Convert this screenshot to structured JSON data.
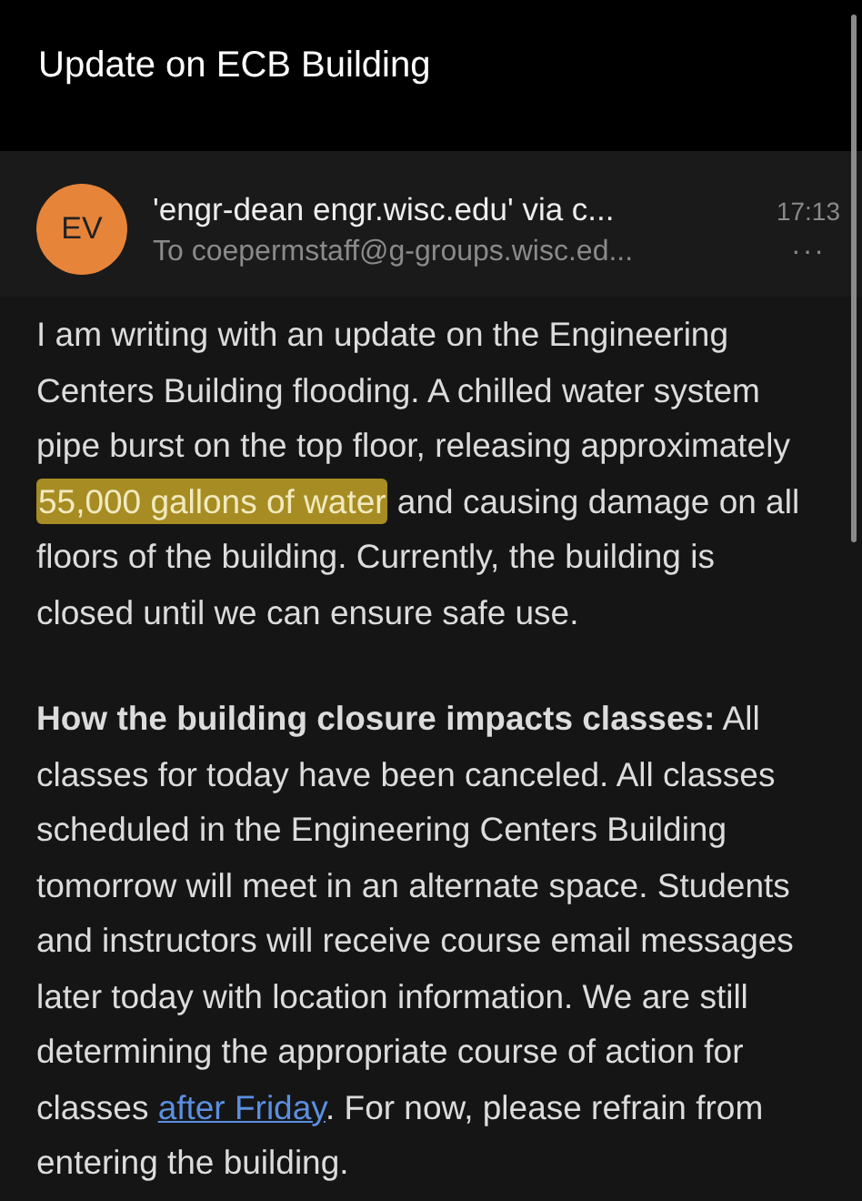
{
  "header": {
    "title": "Update on ECB Building"
  },
  "message": {
    "avatar_initials": "EV",
    "sender": "'engr-dean engr.wisc.edu' via c...",
    "time": "17:13",
    "recipient": "To coepermstaff@g-groups.wisc.ed...",
    "more": "···"
  },
  "body": [
    [
      {
        "kind": "plain",
        "text": "I am writing with an update on the Engineering Centers Building flooding. A chilled water system pipe burst on the top floor, releasing approximately "
      },
      {
        "kind": "highlight",
        "text": "55,000 gallons of water"
      },
      {
        "kind": "plain",
        "text": " and causing damage on all floors of the building. Currently, the building is closed until we can ensure safe use."
      }
    ],
    [
      {
        "kind": "bold",
        "text": "How the building closure impacts classes:"
      },
      {
        "kind": "plain",
        "text": " All classes for today have been canceled. All classes scheduled in the Engineering Centers Building tomorrow will meet in an alternate space. Students and instructors will receive course email messages later today with location information.  We are still determining the appropriate course of action for classes "
      },
      {
        "kind": "link",
        "text": "after Friday"
      },
      {
        "kind": "plain",
        "text": ". For now, please refrain from entering the building."
      }
    ]
  ]
}
